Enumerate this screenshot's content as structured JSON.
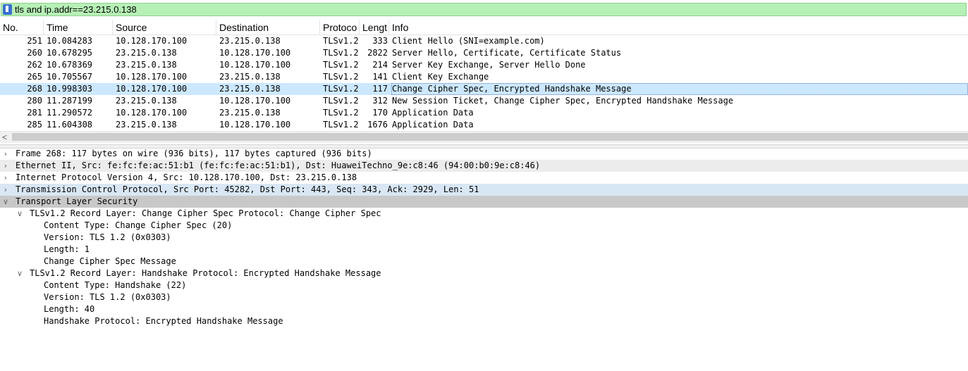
{
  "filter": {
    "value": "tls and ip.addr==23.215.0.138"
  },
  "columns": {
    "no": "No.",
    "time": "Time",
    "source": "Source",
    "destination": "Destination",
    "protocol": "Protoco",
    "length": "Lengt",
    "info": "Info",
    "sort_indicator": "^"
  },
  "packets": [
    {
      "no": "251",
      "time": "10.084283",
      "src": "10.128.170.100",
      "dst": "23.215.0.138",
      "proto": "TLSv1.2",
      "len": "333",
      "info": "Client Hello (SNI=example.com)"
    },
    {
      "no": "260",
      "time": "10.678295",
      "src": "23.215.0.138",
      "dst": "10.128.170.100",
      "proto": "TLSv1.2",
      "len": "2822",
      "info": "Server Hello, Certificate, Certificate Status"
    },
    {
      "no": "262",
      "time": "10.678369",
      "src": "23.215.0.138",
      "dst": "10.128.170.100",
      "proto": "TLSv1.2",
      "len": "214",
      "info": "Server Key Exchange, Server Hello Done"
    },
    {
      "no": "265",
      "time": "10.705567",
      "src": "10.128.170.100",
      "dst": "23.215.0.138",
      "proto": "TLSv1.2",
      "len": "141",
      "info": "Client Key Exchange"
    },
    {
      "no": "268",
      "time": "10.998303",
      "src": "10.128.170.100",
      "dst": "23.215.0.138",
      "proto": "TLSv1.2",
      "len": "117",
      "info": "Change Cipher Spec, Encrypted Handshake Message"
    },
    {
      "no": "280",
      "time": "11.287199",
      "src": "23.215.0.138",
      "dst": "10.128.170.100",
      "proto": "TLSv1.2",
      "len": "312",
      "info": "New Session Ticket, Change Cipher Spec, Encrypted Handshake Message"
    },
    {
      "no": "281",
      "time": "11.290572",
      "src": "10.128.170.100",
      "dst": "23.215.0.138",
      "proto": "TLSv1.2",
      "len": "170",
      "info": "Application Data"
    },
    {
      "no": "285",
      "time": "11.604308",
      "src": "23.215.0.138",
      "dst": "10.128.170.100",
      "proto": "TLSv1.2",
      "len": "1676",
      "info": "Application Data"
    }
  ],
  "selected_packet": "268",
  "details": [
    {
      "text": "Frame 268: 117 bytes on wire (936 bits), 117 bytes captured (936 bits)",
      "twisty": ">"
    },
    {
      "text": "Ethernet II, Src: fe:fc:fe:ac:51:b1 (fe:fc:fe:ac:51:b1), Dst: HuaweiTechno_9e:c8:46 (94:00:b0:9e:c8:46)",
      "twisty": ">"
    },
    {
      "text": "Internet Protocol Version 4, Src: 10.128.170.100, Dst: 23.215.0.138",
      "twisty": ">"
    },
    {
      "text": "Transmission Control Protocol, Src Port: 45282, Dst Port: 443, Seq: 343, Ack: 2929, Len: 51",
      "twisty": ">"
    },
    {
      "text": "Transport Layer Security",
      "twisty": "v"
    },
    {
      "text": "TLSv1.2 Record Layer: Change Cipher Spec Protocol: Change Cipher Spec",
      "twisty": "v"
    },
    {
      "text": "Content Type: Change Cipher Spec (20)",
      "twisty": ""
    },
    {
      "text": "Version: TLS 1.2 (0x0303)",
      "twisty": ""
    },
    {
      "text": "Length: 1",
      "twisty": ""
    },
    {
      "text": "Change Cipher Spec Message",
      "twisty": ""
    },
    {
      "text": "TLSv1.2 Record Layer: Handshake Protocol: Encrypted Handshake Message",
      "twisty": "v"
    },
    {
      "text": "Content Type: Handshake (22)",
      "twisty": ""
    },
    {
      "text": "Version: TLS 1.2 (0x0303)",
      "twisty": ""
    },
    {
      "text": "Length: 40",
      "twisty": ""
    },
    {
      "text": "Handshake Protocol: Encrypted Handshake Message",
      "twisty": ""
    }
  ],
  "scrollbar": {
    "left_arrow": "<"
  },
  "colors": {
    "filter_valid_bg": "#b7f0b6",
    "selected_row_bg": "#cce8ff",
    "detail_selected_bg": "#c8c8c8"
  }
}
